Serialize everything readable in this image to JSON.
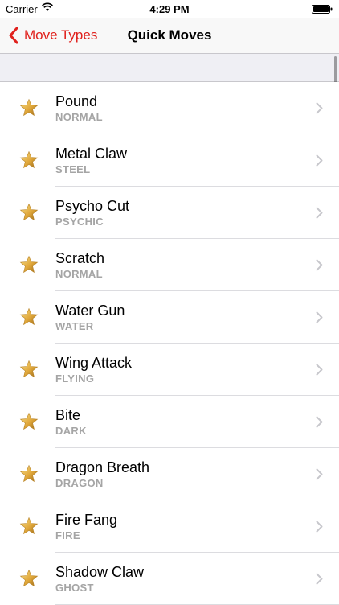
{
  "status_bar": {
    "carrier": "Carrier",
    "time": "4:29 PM"
  },
  "nav": {
    "back_label": "Move Types",
    "title": "Quick Moves"
  },
  "accent_color": "#e0211d",
  "moves": [
    {
      "name": "Pound",
      "type": "NORMAL"
    },
    {
      "name": "Metal Claw",
      "type": "STEEL"
    },
    {
      "name": "Psycho Cut",
      "type": "PSYCHIC"
    },
    {
      "name": "Scratch",
      "type": "NORMAL"
    },
    {
      "name": "Water Gun",
      "type": "WATER"
    },
    {
      "name": "Wing Attack",
      "type": "FLYING"
    },
    {
      "name": "Bite",
      "type": "DARK"
    },
    {
      "name": "Dragon Breath",
      "type": "DRAGON"
    },
    {
      "name": "Fire Fang",
      "type": "FIRE"
    },
    {
      "name": "Shadow Claw",
      "type": "GHOST"
    }
  ],
  "row_icon": "gold-star-icon",
  "row_accessory": "chevron-right-icon"
}
